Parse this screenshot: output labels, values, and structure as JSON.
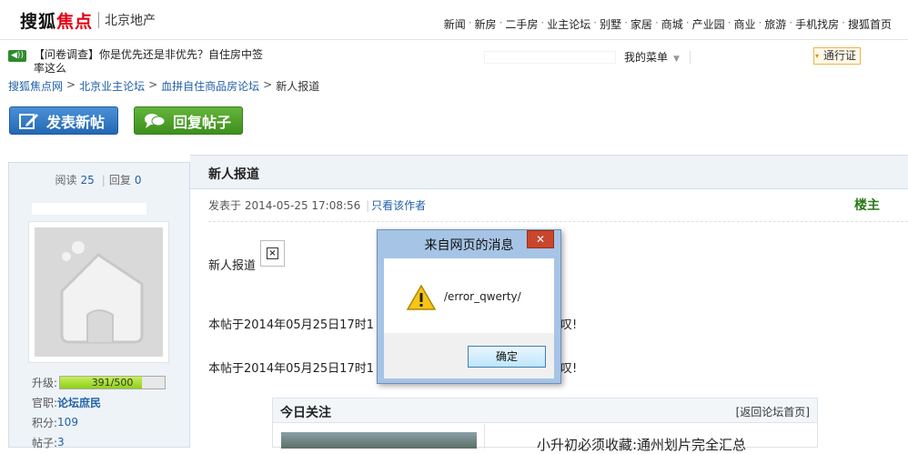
{
  "header": {
    "logo_sohu": "搜狐",
    "logo_jiaodian": "焦点",
    "city": "北京地产",
    "nav": [
      "新闻",
      "新房",
      "二手房",
      "业主论坛",
      "别墅",
      "家居",
      "商城",
      "产业园",
      "商业",
      "旅游",
      "手机找房",
      "搜狐首页"
    ]
  },
  "bar2": {
    "speaker_label": "◀))",
    "survey": "【问卷调查】你是优先还是非优先？自住房中签率这么",
    "my_menu": "我的菜单",
    "passport": "通行证"
  },
  "breadcrumb": {
    "items": [
      "搜狐焦点网",
      "北京业主论坛",
      "血拼自住商品房论坛"
    ],
    "current": "新人报道"
  },
  "actions": {
    "post": "发表新帖",
    "reply": "回复帖子"
  },
  "user": {
    "read_label": "阅读",
    "read_count": "25",
    "reply_label": "回复",
    "reply_count": "0",
    "level_label": "升级:",
    "level_value": "391/500",
    "level_fraction": 0.782,
    "rank_label": "官职:",
    "rank_value": "论坛庶民",
    "points_label": "积分:",
    "points_value": "109",
    "posts_label": "帖子:",
    "posts_value": "3"
  },
  "post": {
    "title": "新人报道",
    "posted_prefix": "发表于",
    "posted_time": "2014-05-25 17:08:56",
    "only_author": "只看该作者",
    "floor": "楼主",
    "body_line1": "新人报道",
    "body_line2": "本帖于2014年05月25日17时1",
    "body_line2_tail": "叹!",
    "body_line3": "本帖于2014年05月25日17时1",
    "body_line3_tail": "叹!"
  },
  "today": {
    "title": "今日关注",
    "back": "[返回论坛首页]",
    "headline": "小升初必须收藏:通州划片完全汇总"
  },
  "dialog": {
    "title": "来自网页的消息",
    "close": "✕",
    "message": "/error_qwerty/",
    "ok": "确定"
  },
  "colors": {
    "link": "#2161a8",
    "brand_red": "#e60012",
    "post_button": "#2e73c0",
    "reply_button": "#4aa12a"
  }
}
